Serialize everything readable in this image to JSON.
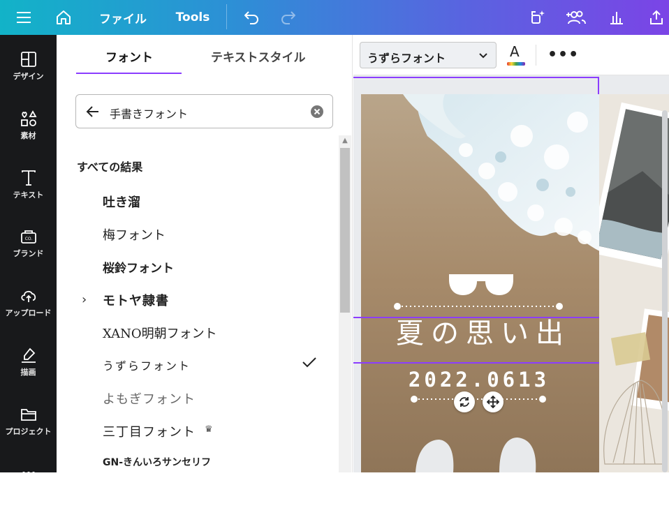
{
  "topbar": {
    "file_label": "ファイル",
    "tools_label": "Tools"
  },
  "rail": {
    "items": [
      {
        "label": "デザイン",
        "icon": "layout-icon"
      },
      {
        "label": "素材",
        "icon": "elements-icon"
      },
      {
        "label": "テキスト",
        "icon": "text-icon"
      },
      {
        "label": "ブランド",
        "icon": "brand-icon"
      },
      {
        "label": "アップロード",
        "icon": "upload-cloud-icon"
      },
      {
        "label": "描画",
        "icon": "draw-icon"
      },
      {
        "label": "プロジェクト",
        "icon": "folder-icon"
      }
    ]
  },
  "panel": {
    "tabs": [
      {
        "label": "フォント",
        "active": true
      },
      {
        "label": "テキストスタイル",
        "active": false
      }
    ],
    "search": {
      "value": "手書きフォント"
    },
    "section_title": "すべての結果",
    "fonts": [
      {
        "name": "吐き溜"
      },
      {
        "name": "梅フォント"
      },
      {
        "name": "桜鈴フォント"
      },
      {
        "name": "モトヤ隷書",
        "expandable": true
      },
      {
        "name": "XANO明朝フォント"
      },
      {
        "name": "うずらフォント",
        "selected": true
      },
      {
        "name": "よもぎフォント"
      },
      {
        "name": "三丁目フォント",
        "premium": true
      },
      {
        "name": "GN-きんいろサンセリフ"
      }
    ]
  },
  "toolbar": {
    "font_value": "うずらフォント",
    "color_label": "A",
    "more_label": "•••"
  },
  "canvas": {
    "title_text": "夏の思い出",
    "date_text": "2022.0613"
  },
  "colors": {
    "accent": "#8b3dff",
    "rail_bg": "#18191b"
  }
}
